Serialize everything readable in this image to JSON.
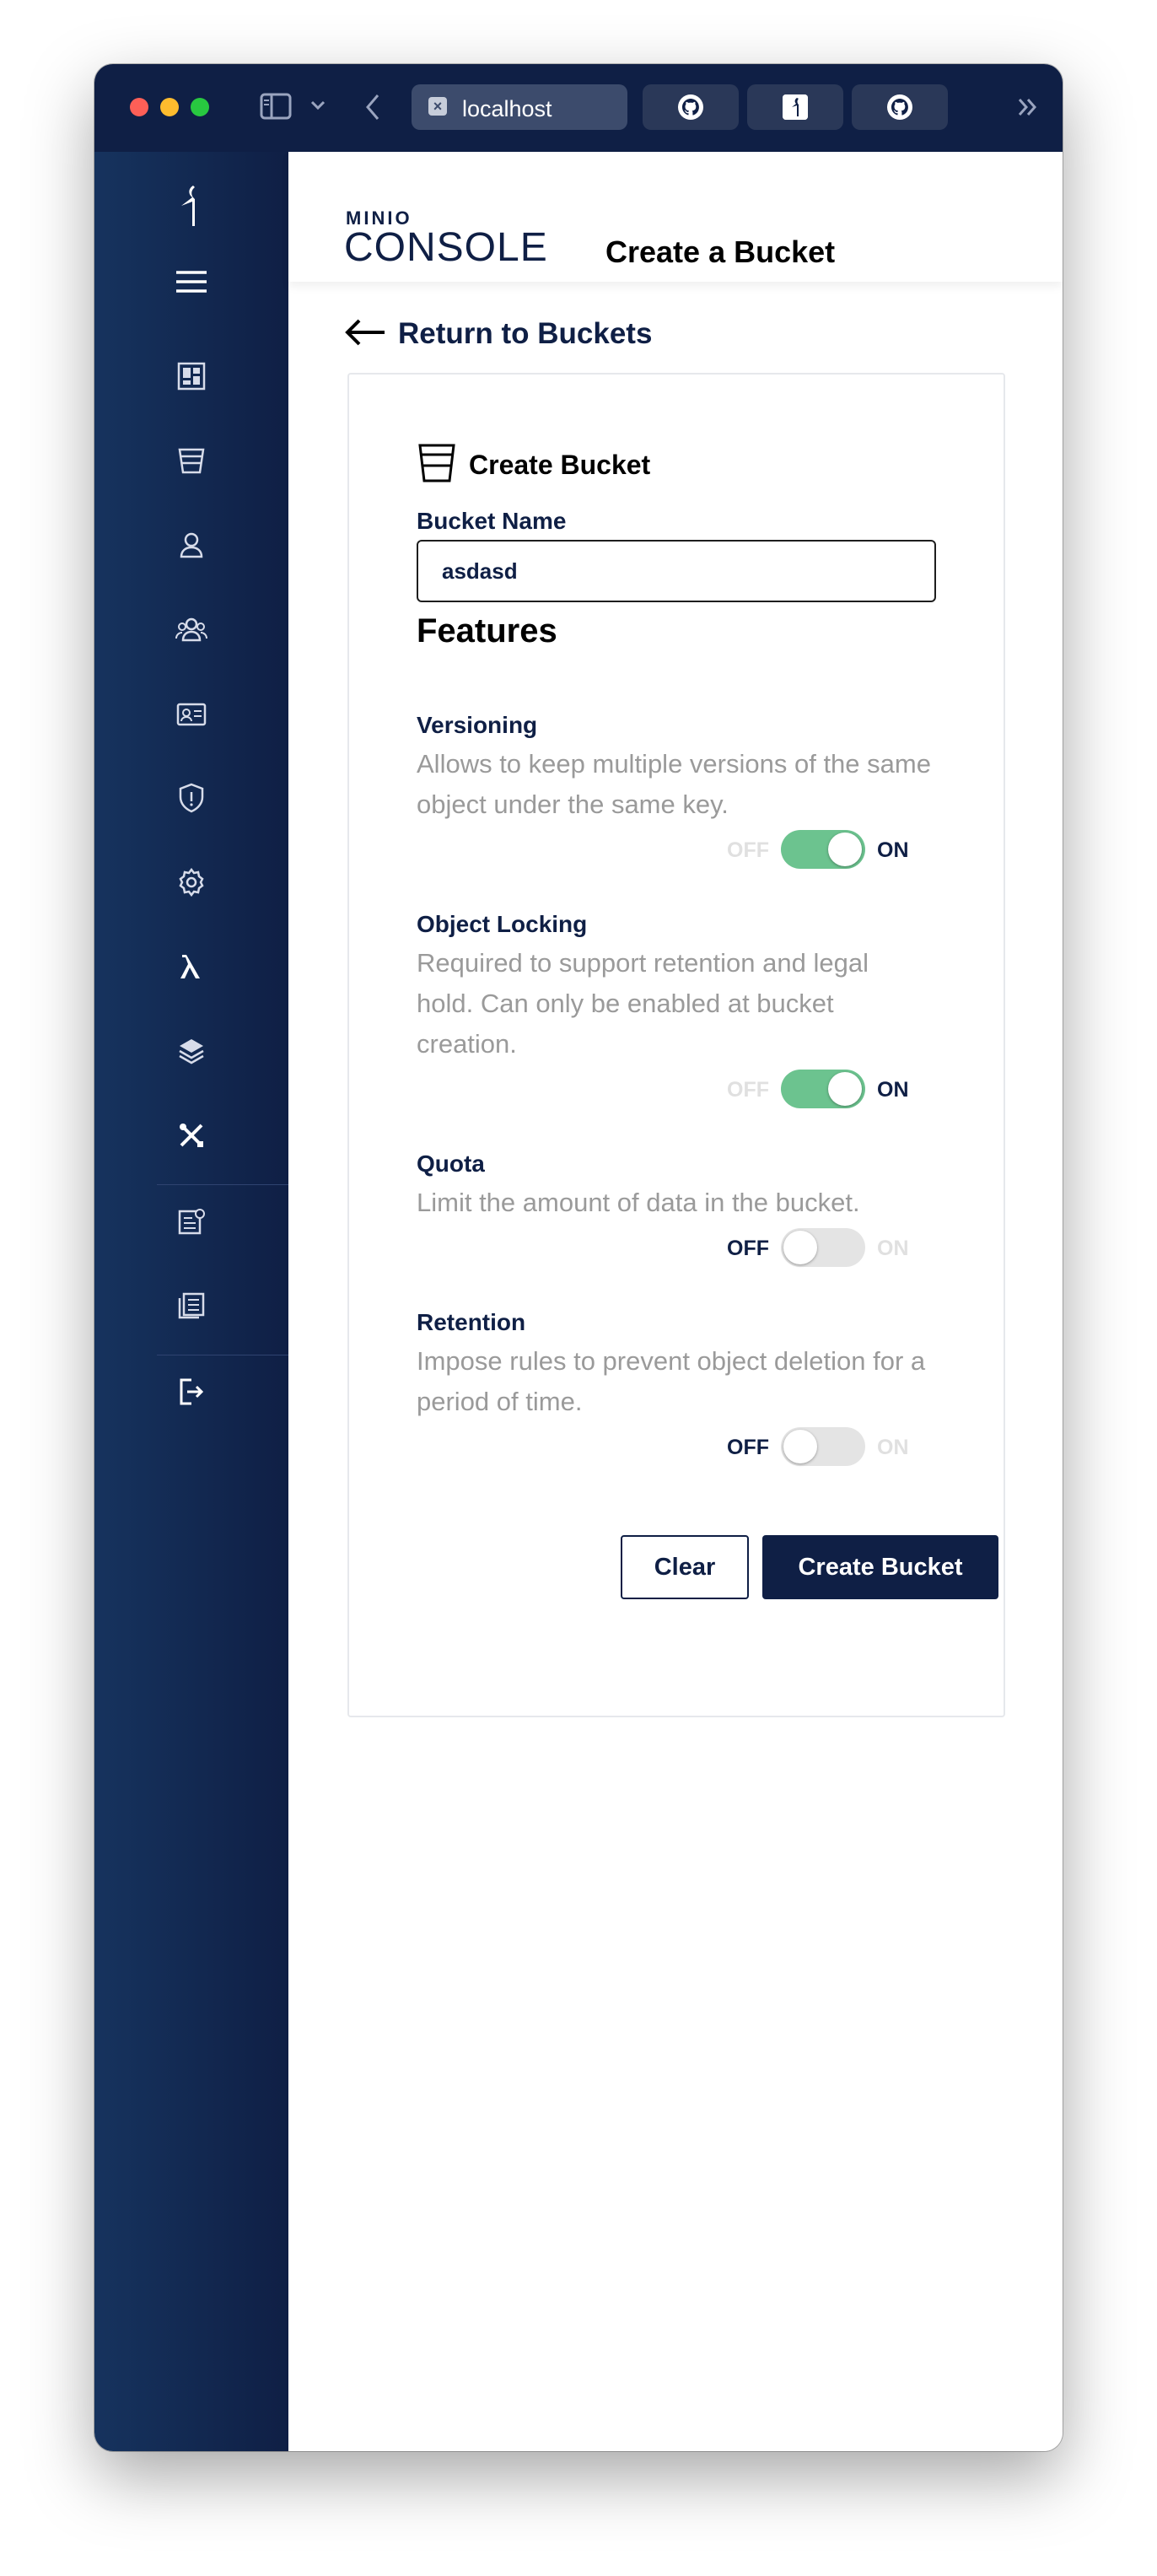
{
  "browser": {
    "active_tab_label": "localhost",
    "tab_icons": [
      "close-icon",
      "github-icon",
      "minio-icon",
      "github-icon"
    ]
  },
  "header": {
    "logo_top": "MINIO",
    "logo_main": "CONSOLE",
    "title": "Create a Bucket"
  },
  "nav": {
    "back_label": "Return to Buckets"
  },
  "sidebar": {
    "items": [
      "minio-logo-icon",
      "menu-icon",
      "dashboard-icon",
      "buckets-icon",
      "users-icon",
      "groups-icon",
      "service-accounts-icon",
      "policies-icon",
      "settings-icon",
      "lambda-icon",
      "tiers-icon",
      "tools-icon",
      "license-icon",
      "documentation-icon",
      "logout-icon"
    ]
  },
  "form": {
    "card_title": "Create Bucket",
    "bucket_name_label": "Bucket Name",
    "bucket_name_value": "asdasd",
    "features_heading": "Features",
    "versioning": {
      "title": "Versioning",
      "description": "Allows to keep multiple versions of the same object under the same key.",
      "off_label": "OFF",
      "on_label": "ON",
      "enabled": true
    },
    "object_locking": {
      "title": "Object Locking",
      "description": "Required to support retention and legal hold. Can only be enabled at bucket creation.",
      "off_label": "OFF",
      "on_label": "ON",
      "enabled": true
    },
    "quota": {
      "title": "Quota",
      "description": "Limit the amount of data in the bucket.",
      "off_label": "OFF",
      "on_label": "ON",
      "enabled": false
    },
    "retention": {
      "title": "Retention",
      "description": "Impose rules to prevent object deletion for a period of time.",
      "off_label": "OFF",
      "on_label": "ON",
      "enabled": false
    },
    "clear_label": "Clear",
    "create_label": "Create Bucket"
  },
  "colors": {
    "brand_navy": "#0f1f45",
    "toggle_on": "#6cc38f",
    "toggle_off": "#e4e4e4",
    "muted_text": "#9a9a9a"
  }
}
